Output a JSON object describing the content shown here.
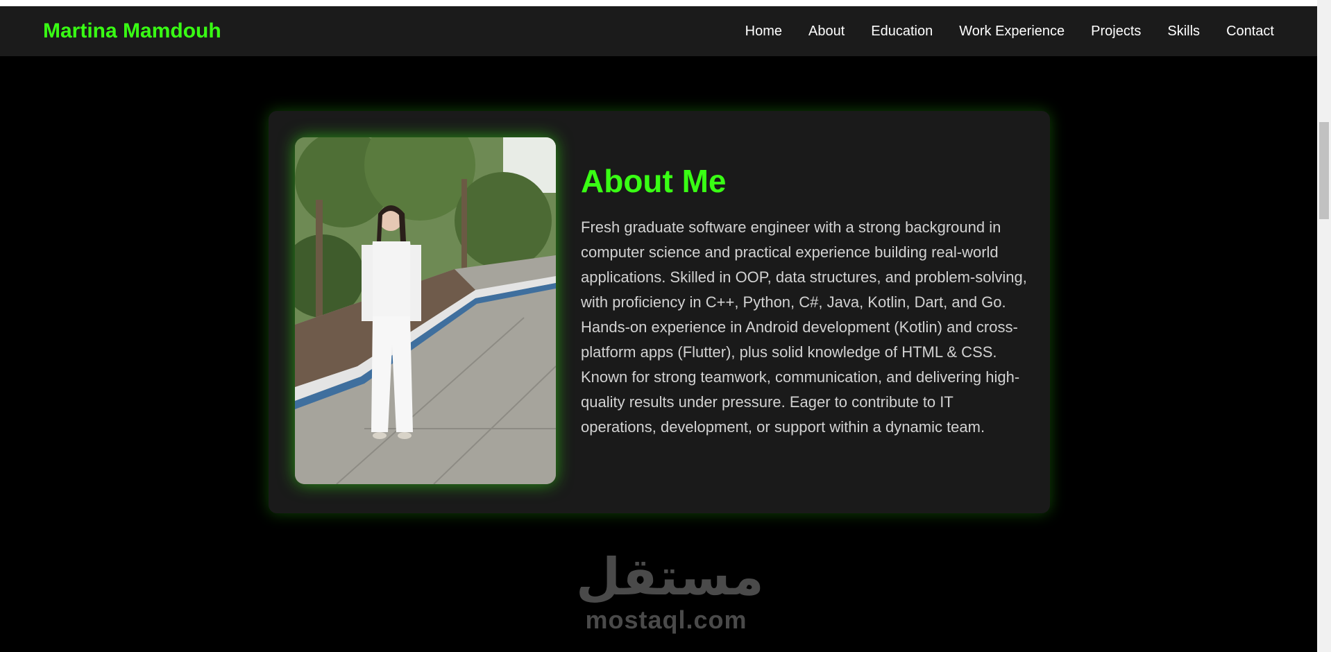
{
  "navbar": {
    "brand": "Martina Mamdouh",
    "links": [
      "Home",
      "About",
      "Education",
      "Work Experience",
      "Projects",
      "Skills",
      "Contact"
    ]
  },
  "about": {
    "title": "About Me",
    "text": "Fresh graduate software engineer with a strong background in computer science and practical experience building real-world applications. Skilled in OOP, data structures, and problem-solving, with proficiency in C++, Python, C#, Java, Kotlin, Dart, and Go. Hands-on experience in Android development (Kotlin) and cross-platform apps (Flutter), plus solid knowledge of HTML & CSS. Known for strong teamwork, communication, and delivering high-quality results under pressure. Eager to contribute to IT operations, development, or support within a dynamic team."
  },
  "watermark": {
    "arabic": "مستقل",
    "latin": "mostaql.com"
  },
  "colors": {
    "accent": "#39ff14",
    "background": "#000000",
    "card": "#1a1a1a",
    "navbar": "#1b1b1b"
  }
}
